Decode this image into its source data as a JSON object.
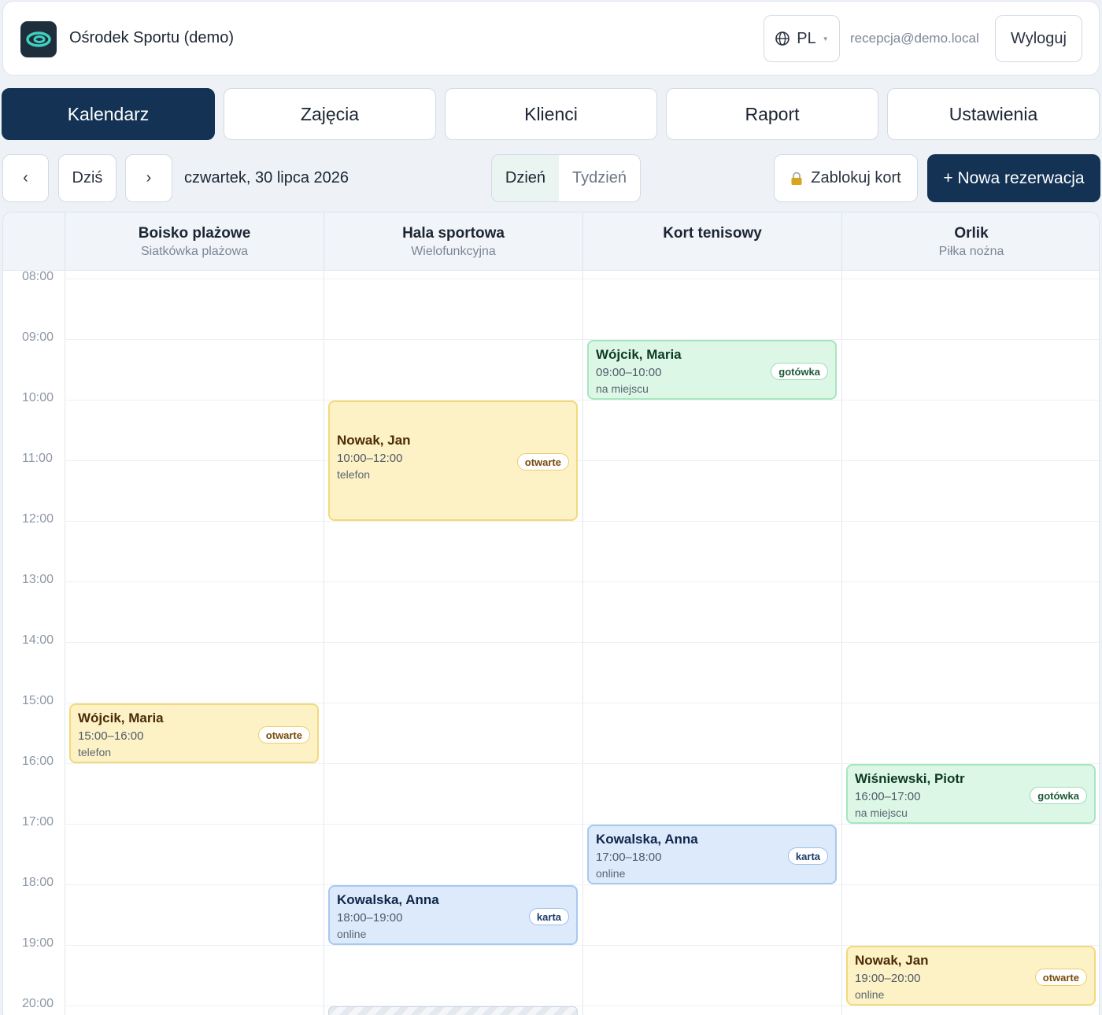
{
  "app": {
    "title": "Ośrodek Sportu (demo)"
  },
  "header": {
    "language": "PL",
    "user_email": "recepcja@demo.local",
    "logout_label": "Wyloguj"
  },
  "tabs": [
    {
      "label": "Kalendarz",
      "active": true
    },
    {
      "label": "Zajęcia",
      "active": false
    },
    {
      "label": "Klienci",
      "active": false
    },
    {
      "label": "Raport",
      "active": false
    },
    {
      "label": "Ustawienia",
      "active": false
    }
  ],
  "toolbar": {
    "prev_label": "‹",
    "today_label": "Dziś",
    "next_label": "›",
    "date": "czwartek, 30 lipca 2026",
    "view_day": "Dzień",
    "view_week": "Tydzień",
    "block_label": "Zablokuj kort",
    "new_label": "+ Nowa rezerwacja"
  },
  "calendar": {
    "columns": [
      {
        "name": "Boisko plażowe",
        "sub": "Siatkówka plażowa"
      },
      {
        "name": "Hala sportowa",
        "sub": "Wielofunkcyjna"
      },
      {
        "name": "Kort tenisowy",
        "sub": ""
      },
      {
        "name": "Orlik",
        "sub": "Piłka nożna"
      }
    ],
    "hours": [
      "08:00",
      "09:00",
      "10:00",
      "11:00",
      "12:00",
      "13:00",
      "14:00",
      "15:00",
      "16:00",
      "17:00",
      "18:00",
      "19:00",
      "20:00"
    ],
    "events": [
      {
        "column": 2,
        "name": "Wójcik, Maria",
        "time": "09:00–10:00",
        "source": "na miejscu",
        "badge": "gotówka",
        "color": "green",
        "start": 9,
        "end": 10
      },
      {
        "column": 1,
        "name": "Nowak, Jan",
        "time": "10:00–12:00",
        "source": "telefon",
        "badge": "otwarte",
        "color": "yellow",
        "start": 10,
        "end": 12
      },
      {
        "column": 0,
        "name": "Wójcik, Maria",
        "time": "15:00–16:00",
        "source": "telefon",
        "badge": "otwarte",
        "color": "yellow",
        "start": 15,
        "end": 16
      },
      {
        "column": 3,
        "name": "Wiśniewski, Piotr",
        "time": "16:00–17:00",
        "source": "na miejscu",
        "badge": "gotówka",
        "color": "green",
        "start": 16,
        "end": 17
      },
      {
        "column": 2,
        "name": "Kowalska, Anna",
        "time": "17:00–18:00",
        "source": "online",
        "badge": "karta",
        "color": "blue",
        "start": 17,
        "end": 18
      },
      {
        "column": 1,
        "name": "Kowalska, Anna",
        "time": "18:00–19:00",
        "source": "online",
        "badge": "karta",
        "color": "blue",
        "start": 18,
        "end": 19
      },
      {
        "column": 3,
        "name": "Nowak, Jan",
        "time": "19:00–20:00",
        "source": "online",
        "badge": "otwarte",
        "color": "yellow",
        "start": 19,
        "end": 20
      }
    ],
    "blocked": [
      {
        "column": 1,
        "start": 20,
        "end": 21
      }
    ]
  }
}
